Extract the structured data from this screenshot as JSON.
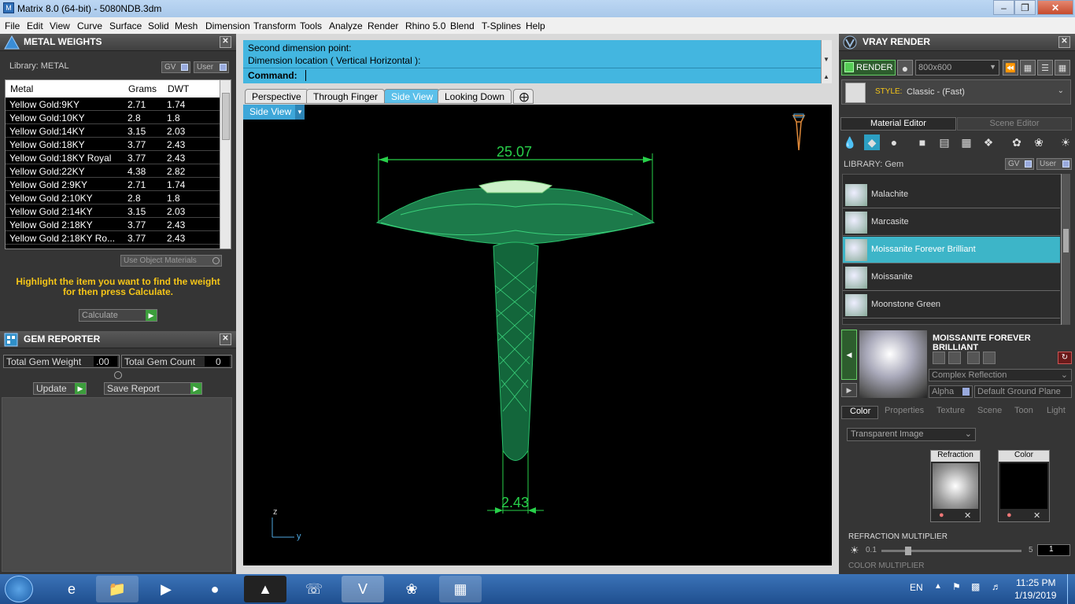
{
  "window": {
    "title": "Matrix 8.0 (64-bit) - 5080NDB.3dm"
  },
  "menu": [
    "File",
    "Edit",
    "View",
    "Curve",
    "Surface",
    "Solid",
    "Mesh",
    "Dimension",
    "Transform",
    "Tools",
    "Analyze",
    "Render",
    "Rhino 5.0",
    "Blend",
    "T-Splines",
    "Help"
  ],
  "metal_weights": {
    "title": "METAL WEIGHTS",
    "library_label": "Library: METAL",
    "gv_label": "GV",
    "user_label": "User",
    "columns": [
      "Metal",
      "Grams",
      "DWT"
    ],
    "rows": [
      [
        "Yellow Gold:9KY",
        "2.71",
        "1.74"
      ],
      [
        "Yellow Gold:10KY",
        "2.8",
        "1.8"
      ],
      [
        "Yellow Gold:14KY",
        "3.15",
        "2.03"
      ],
      [
        "Yellow Gold:18KY",
        "3.77",
        "2.43"
      ],
      [
        "Yellow Gold:18KY Royal",
        "3.77",
        "2.43"
      ],
      [
        "Yellow Gold:22KY",
        "4.38",
        "2.82"
      ],
      [
        "Yellow Gold 2:9KY",
        "2.71",
        "1.74"
      ],
      [
        "Yellow Gold 2:10KY",
        "2.8",
        "1.8"
      ],
      [
        "Yellow Gold 2:14KY",
        "3.15",
        "2.03"
      ],
      [
        "Yellow Gold 2:18KY",
        "3.77",
        "2.43"
      ],
      [
        "Yellow Gold 2:18KY Ro...",
        "3.77",
        "2.43"
      ]
    ],
    "use_object_materials": "Use Object Materials",
    "hint": "Highlight the item you want to find the weight for then press Calculate.",
    "calculate": "Calculate"
  },
  "gem_reporter": {
    "title": "GEM REPORTER",
    "total_weight_label": "Total Gem Weight",
    "total_weight_value": ".00",
    "total_count_label": "Total Gem Count",
    "total_count_value": "0",
    "update": "Update",
    "save_report": "Save Report"
  },
  "command": {
    "line1": "Second dimension point:",
    "line2": "Dimension location ( Vertical  Horizontal ):",
    "prompt": "Command:"
  },
  "view_tabs": [
    "Perspective",
    "Through Finger",
    "Side View",
    "Looking Down"
  ],
  "active_tab": "Side View",
  "viewport": {
    "label": "Side View",
    "dim_top": "25.07",
    "dim_bottom": "2.43",
    "axis_z": "z",
    "axis_y": "y"
  },
  "vray": {
    "title": "VRAY RENDER",
    "render": "RENDER",
    "resolution": "800x600",
    "style_label": "STYLE:",
    "style_value": "Classic - (Fast)",
    "tabs": [
      "Material Editor",
      "Scene Editor"
    ],
    "library_label": "LIBRARY: Gem",
    "gv_label": "GV",
    "user_label": "User",
    "gems": [
      "Malachite",
      "Marcasite",
      "Moissanite Forever Brilliant",
      "Moissanite",
      "Moonstone Green"
    ],
    "selected_gem": "Moissanite Forever Brilliant",
    "material_name": "MOISSANITE FOREVER BRILLIANT",
    "material_type": "Complex Reflection",
    "alpha_label": "Alpha",
    "ground_plane": "Default Ground Plane",
    "subtabs": [
      "Color",
      "Properties",
      "Texture",
      "Scene",
      "Toon",
      "Light"
    ],
    "transparent_dropdown": "Transparent Image",
    "refraction_label": "Refraction",
    "color_label": "Color",
    "refraction_multiplier_label": "REFRACTION MULTIPLIER",
    "slider_min": "0.1",
    "slider_max": "5",
    "slider_value": "1",
    "color_multiplier_label": "COLOR MULTIPLIER"
  },
  "taskbar": {
    "lang": "EN",
    "time": "11:25 PM",
    "date": "1/19/2019"
  }
}
